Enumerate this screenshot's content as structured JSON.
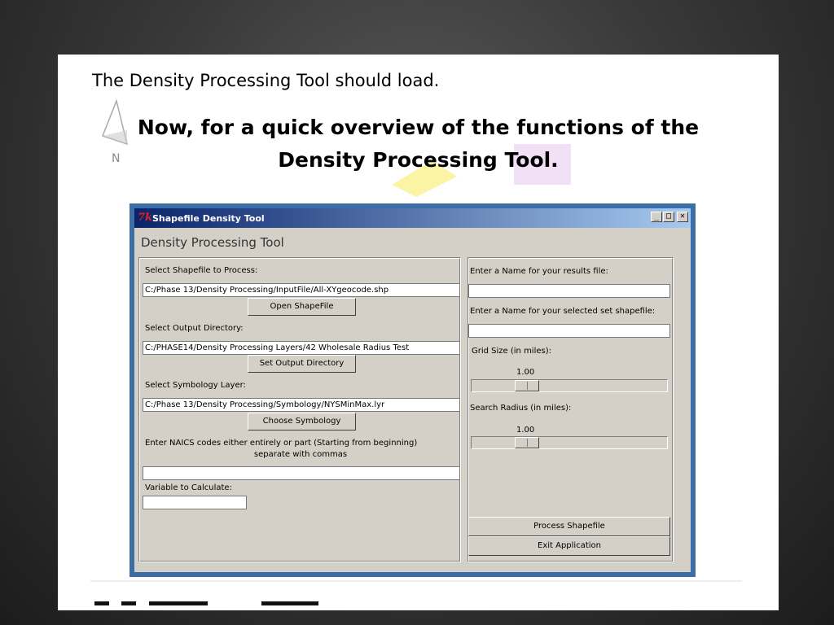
{
  "slide": {
    "intro": "The Density Processing Tool should load.",
    "heading_line1": "Now, for a quick overview of the functions of the",
    "heading_line2": "Density Processing Tool.",
    "compass_label": "N"
  },
  "window": {
    "title": "Shapefile Density Tool",
    "app_icon": "tk-icon",
    "controls": {
      "minimize": "_",
      "maximize": "□",
      "close": "✕"
    },
    "tool_title": "Density Processing Tool"
  },
  "left_panel": {
    "shapefile_label": "Select Shapefile to Process:",
    "shapefile_value": "C:/Phase 13/Density Processing/InputFile/All-XYgeocode.shp",
    "open_button": "Open ShapeFile",
    "output_label": "Select Output Directory:",
    "output_value": "C:/PHASE14/Density Processing Layers/42 Wholesale Radius Test",
    "output_button": "Set Output Directory",
    "symbology_label": "Select Symbology Layer:",
    "symbology_value": "C:/Phase 13/Density Processing/Symbology/NYSMinMax.lyr",
    "symbology_button": "Choose Symbology",
    "naics_label_line1": "Enter NAICS codes either entirely or part (Starting from beginning)",
    "naics_label_line2": "separate with commas",
    "naics_value": "",
    "variable_label": "Variable to Calculate:",
    "variable_value": ""
  },
  "right_panel": {
    "results_label": "Enter a Name for your results file:",
    "results_value": "",
    "selected_label": "Enter a Name for your selected set shapefile:",
    "selected_value": "",
    "grid_label": "Grid Size (in miles):",
    "grid_value": "1.00",
    "grid_level": 0.25,
    "radius_label": "Search Radius (in miles):",
    "radius_value": "1.00",
    "radius_level": 0.25,
    "process_button": "Process Shapefile",
    "exit_button": "Exit Application"
  }
}
